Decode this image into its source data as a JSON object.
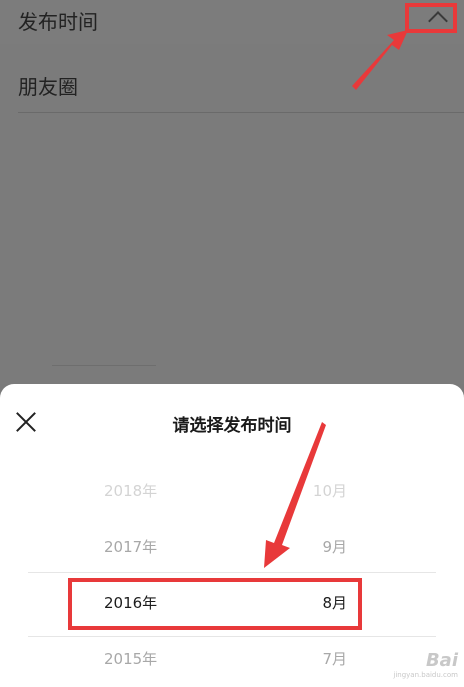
{
  "filter": {
    "label": "发布时间"
  },
  "list": {
    "item_label": "朋友圈"
  },
  "sheet": {
    "title": "请选择发布时间",
    "rows": [
      {
        "year": "2018年",
        "month": "10月"
      },
      {
        "year": "2017年",
        "month": "9月"
      },
      {
        "year": "2016年",
        "month": "8月"
      },
      {
        "year": "2015年",
        "month": "7月"
      }
    ]
  },
  "watermark": {
    "logo": "Bai",
    "sub": "jingyan.baidu.com"
  },
  "colors": {
    "annotation": "#e8393a",
    "overlay": "#7a7a7a",
    "sheet": "#ffffff"
  }
}
